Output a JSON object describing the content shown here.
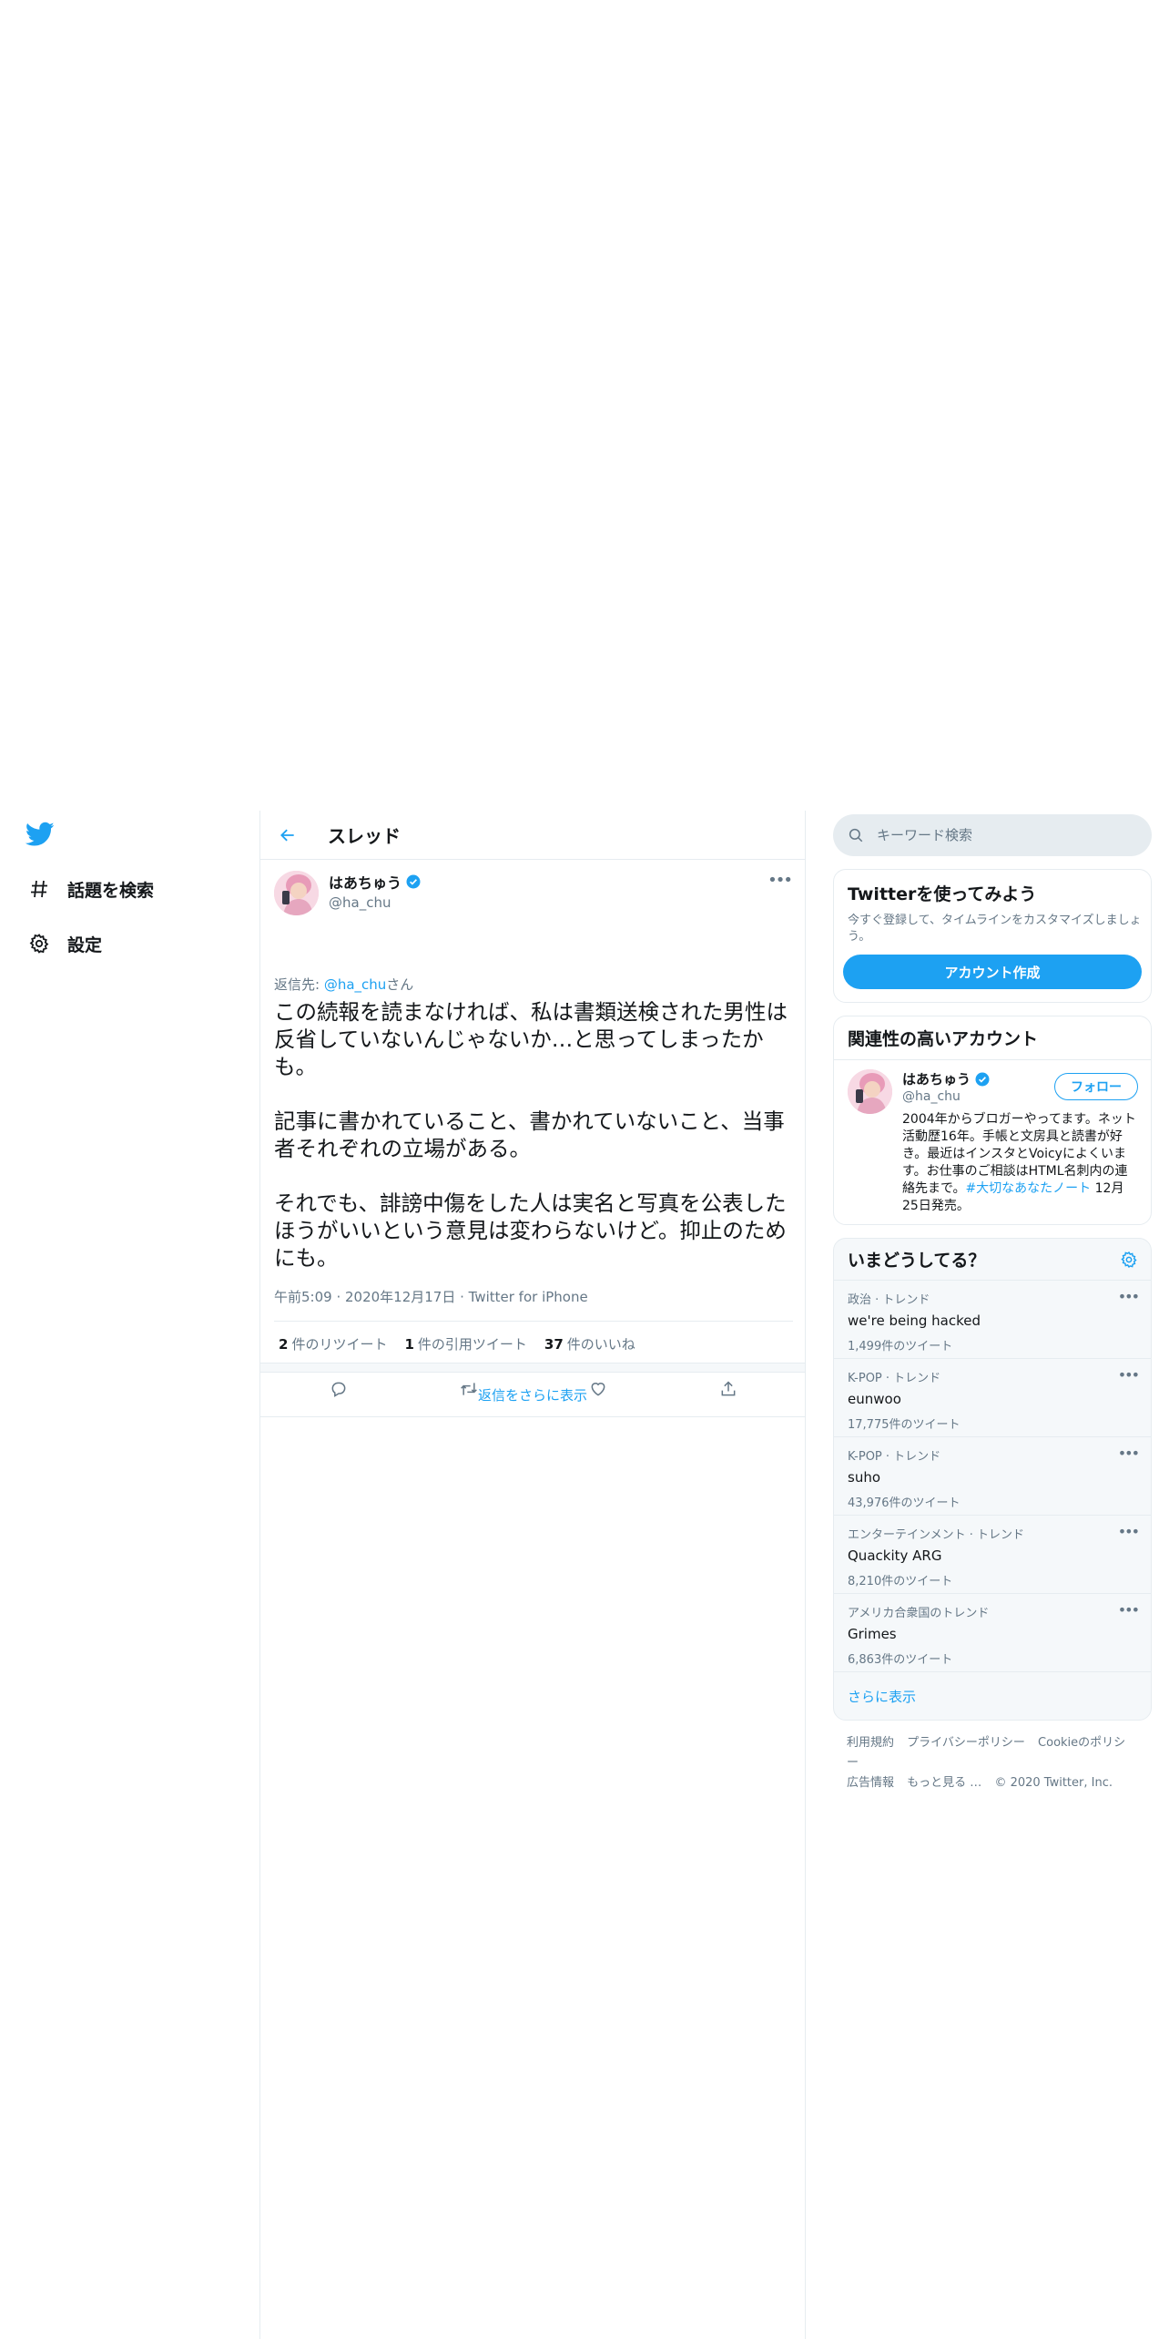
{
  "nav": {
    "items": [
      {
        "label": "話題を検索",
        "icon": "hashtag-icon"
      },
      {
        "label": "設定",
        "icon": "gear-icon"
      }
    ]
  },
  "header": {
    "title": "スレッド"
  },
  "tweet": {
    "author_name": "はあちゅう",
    "author_handle": "@ha_chu",
    "reply_prefix": "返信先: ",
    "reply_mention": "@ha_chu",
    "reply_suffix": "さん",
    "text": "この続報を読まなければ、私は書類送検された男性は反省していないんじゃないか…と思ってしまったかも。\n\n記事に書かれていること、書かれていないこと、当事者それぞれの立場がある。\n\nそれでも、誹謗中傷をした人は実名と写真を公表したほうがいいという意見は変わらないけど。抑止のためにも。",
    "meta": "午前5:09 · 2020年12月17日 · Twitter for iPhone",
    "retweets_count": "2",
    "retweets_label": "件のリツイート",
    "quotes_count": "1",
    "quotes_label": "件の引用ツイート",
    "likes_count": "37",
    "likes_label": "件のいいね"
  },
  "more_replies": "返信をさらに表示",
  "search": {
    "placeholder": "キーワード検索"
  },
  "signup": {
    "title": "Twitterを使ってみよう",
    "desc": "今すぐ登録して、タイムラインをカスタマイズしましょう。",
    "button": "アカウント作成"
  },
  "who": {
    "title": "関連性の高いアカウント",
    "name": "はあちゅう",
    "handle": "@ha_chu",
    "follow": "フォロー",
    "bio_text": "2004年からブロガーやってます。ネット活動歴16年。手帳と文房具と読書が好き。最近はインスタとVoicyによくいます。お仕事のご相談はHTML名刺内の連絡先まで。",
    "bio_link": "#大切なあなたノート",
    "bio_suffix": " 12月25日発売。"
  },
  "trends": {
    "title": "いまどうしてる？",
    "items": [
      {
        "category": "政治 · トレンド",
        "name": "we're being hacked",
        "count": "1,499件のツイート"
      },
      {
        "category": "K-POP · トレンド",
        "name": "eunwoo",
        "count": "17,775件のツイート"
      },
      {
        "category": "K-POP · トレンド",
        "name": "suho",
        "count": "43,976件のツイート"
      },
      {
        "category": "エンターテインメント · トレンド",
        "name": "Quackity ARG",
        "count": "8,210件のツイート"
      },
      {
        "category": "アメリカ合衆国のトレンド",
        "name": "Grimes",
        "count": "6,863件のツイート"
      }
    ],
    "show_more": "さらに表示"
  },
  "footer": {
    "links": [
      "利用規約",
      "プライバシーポリシー",
      "Cookieのポリシー",
      "広告情報",
      "もっと見る …",
      "© 2020 Twitter, Inc."
    ]
  },
  "colors": {
    "accent": "#1da1f2",
    "text": "#14171a",
    "muted": "#657786",
    "border": "#e6ecf0"
  }
}
